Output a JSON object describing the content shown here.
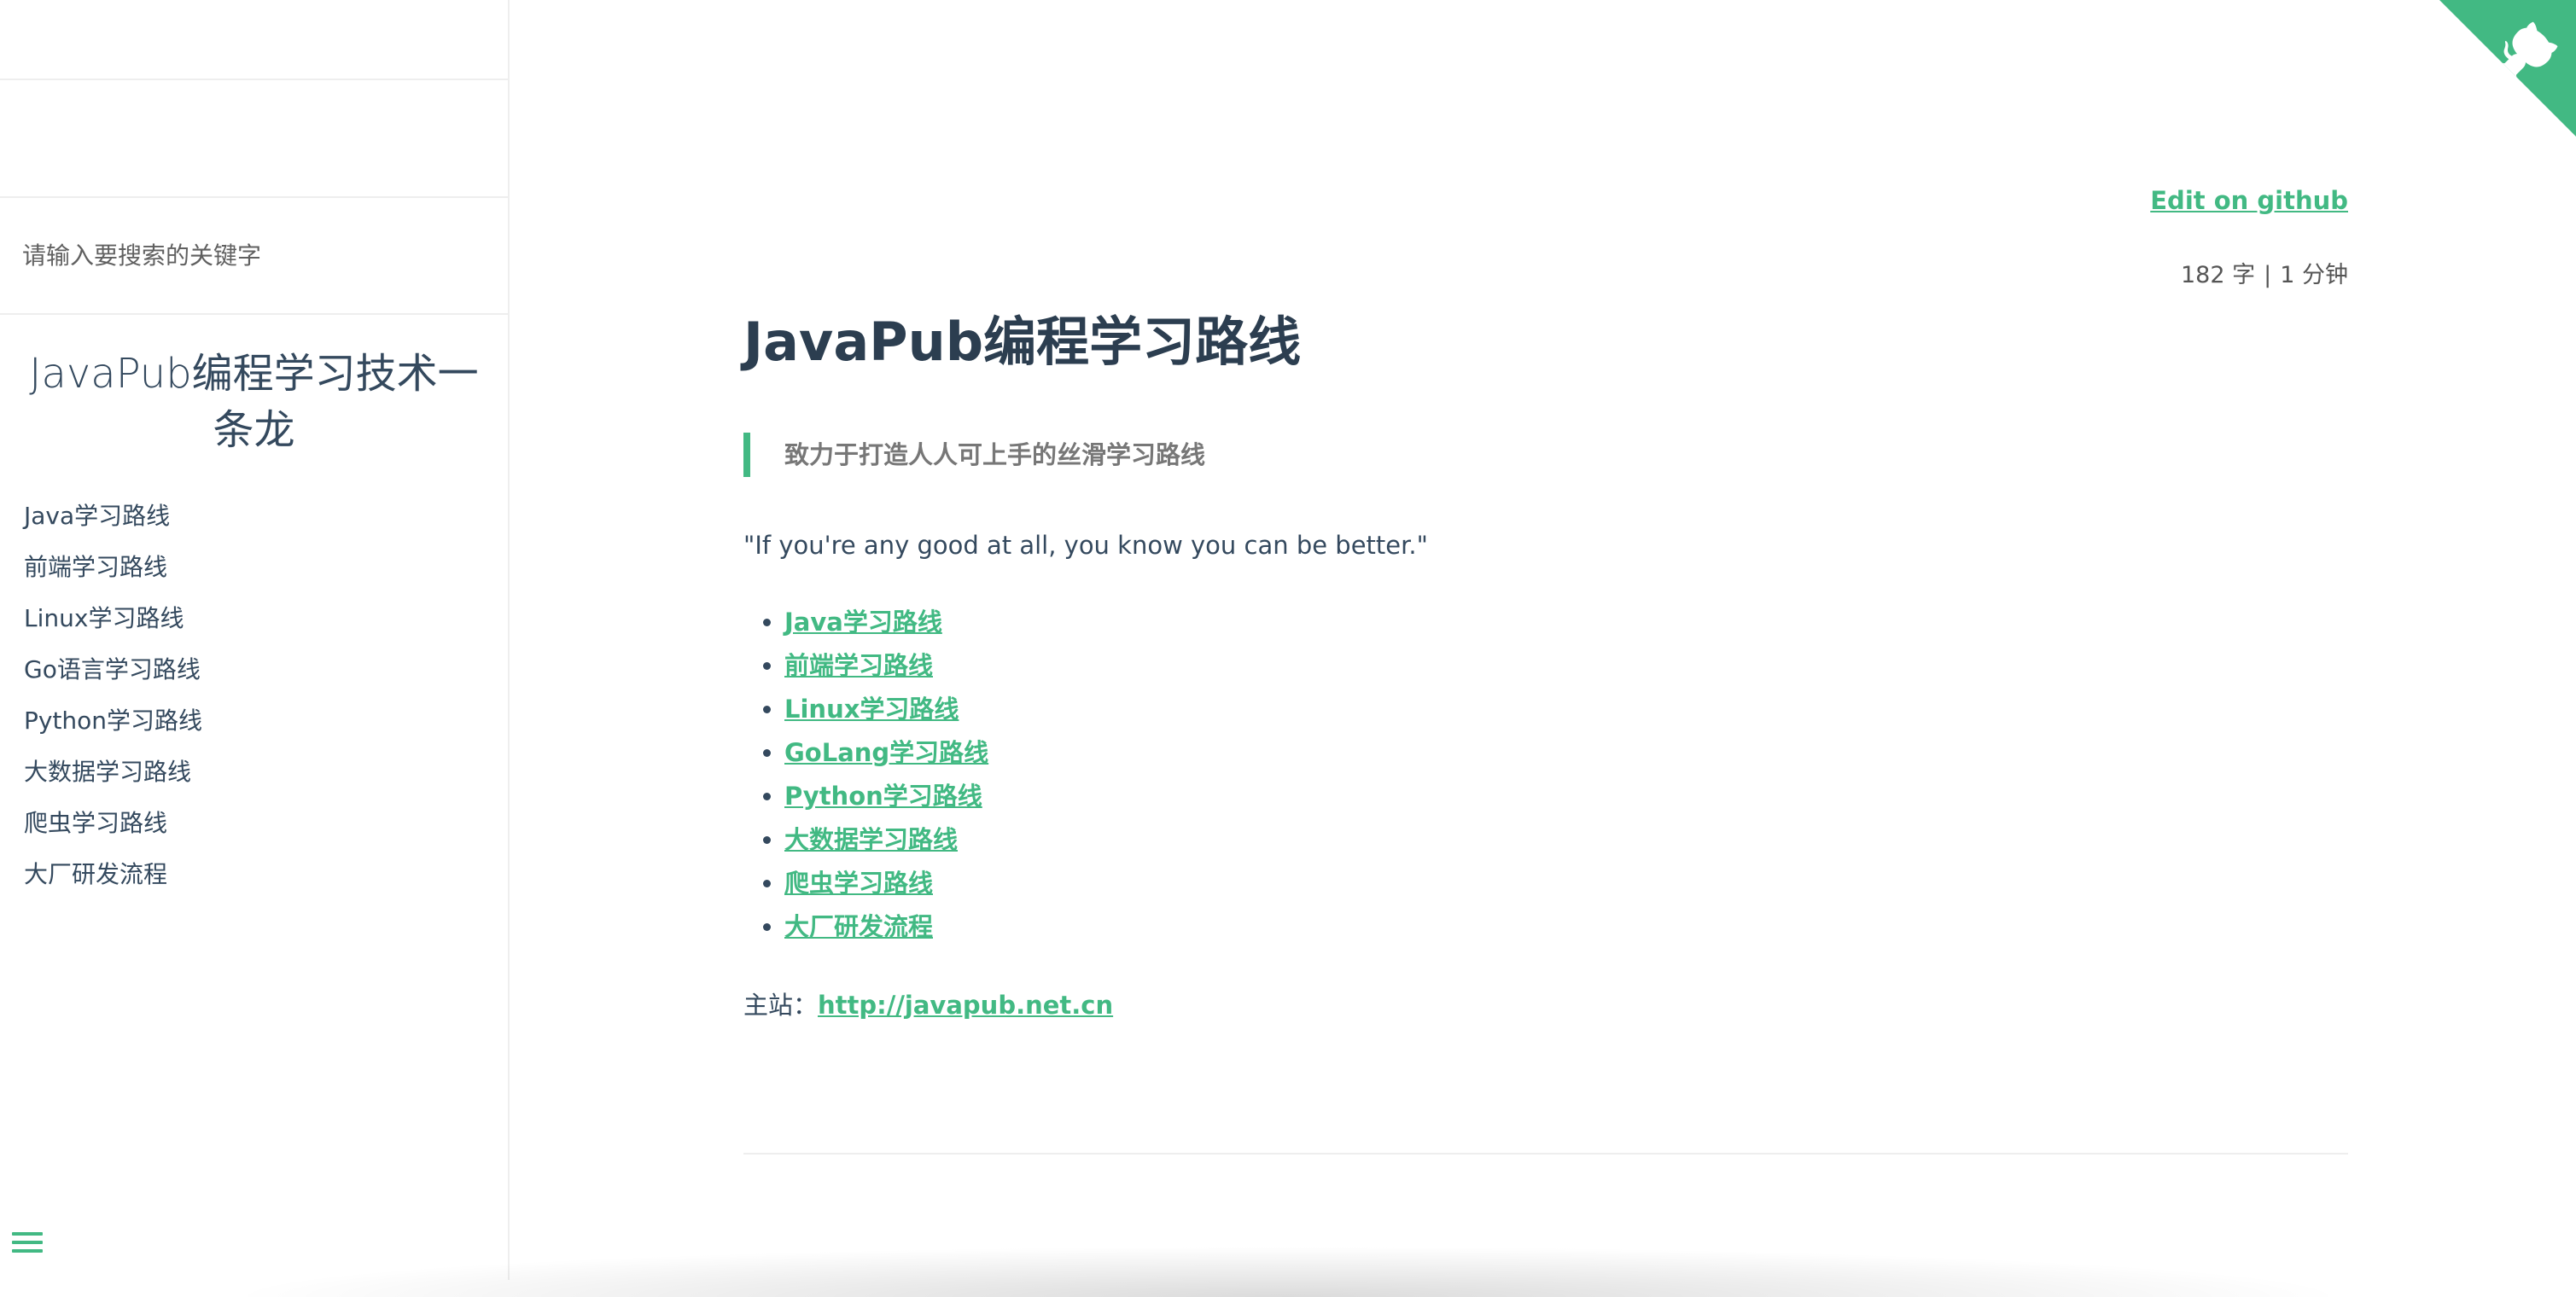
{
  "sidebar": {
    "search_placeholder": "请输入要搜索的关键字",
    "app_name": "JavaPub编程学习技术一条龙",
    "items": [
      {
        "label": "Java学习路线"
      },
      {
        "label": "前端学习路线"
      },
      {
        "label": "Linux学习路线"
      },
      {
        "label": "Go语言学习路线"
      },
      {
        "label": "Python学习路线"
      },
      {
        "label": "大数据学习路线"
      },
      {
        "label": "爬虫学习路线"
      },
      {
        "label": "大厂研发流程"
      }
    ],
    "toggle_icon": "menu-icon"
  },
  "header": {
    "edit_link": "Edit on github",
    "word_count": "182 字",
    "separator": "|",
    "read_time": "1 分钟",
    "corner_icon": "github-octocat-icon"
  },
  "main": {
    "title": "JavaPub编程学习路线",
    "quote": "致力于打造人人可上手的丝滑学习路线",
    "motto": "\"If you're any good at all, you know you can be better.\"",
    "links": [
      {
        "label": "Java学习路线"
      },
      {
        "label": "前端学习路线"
      },
      {
        "label": "Linux学习路线"
      },
      {
        "label": "GoLang学习路线"
      },
      {
        "label": "Python学习路线"
      },
      {
        "label": "大数据学习路线"
      },
      {
        "label": "爬虫学习路线"
      },
      {
        "label": "大厂研发流程"
      }
    ],
    "main_site_label": "主站：",
    "main_site_url": "http://javapub.net.cn"
  },
  "colors": {
    "accent": "#42b983",
    "text": "#34495e"
  }
}
